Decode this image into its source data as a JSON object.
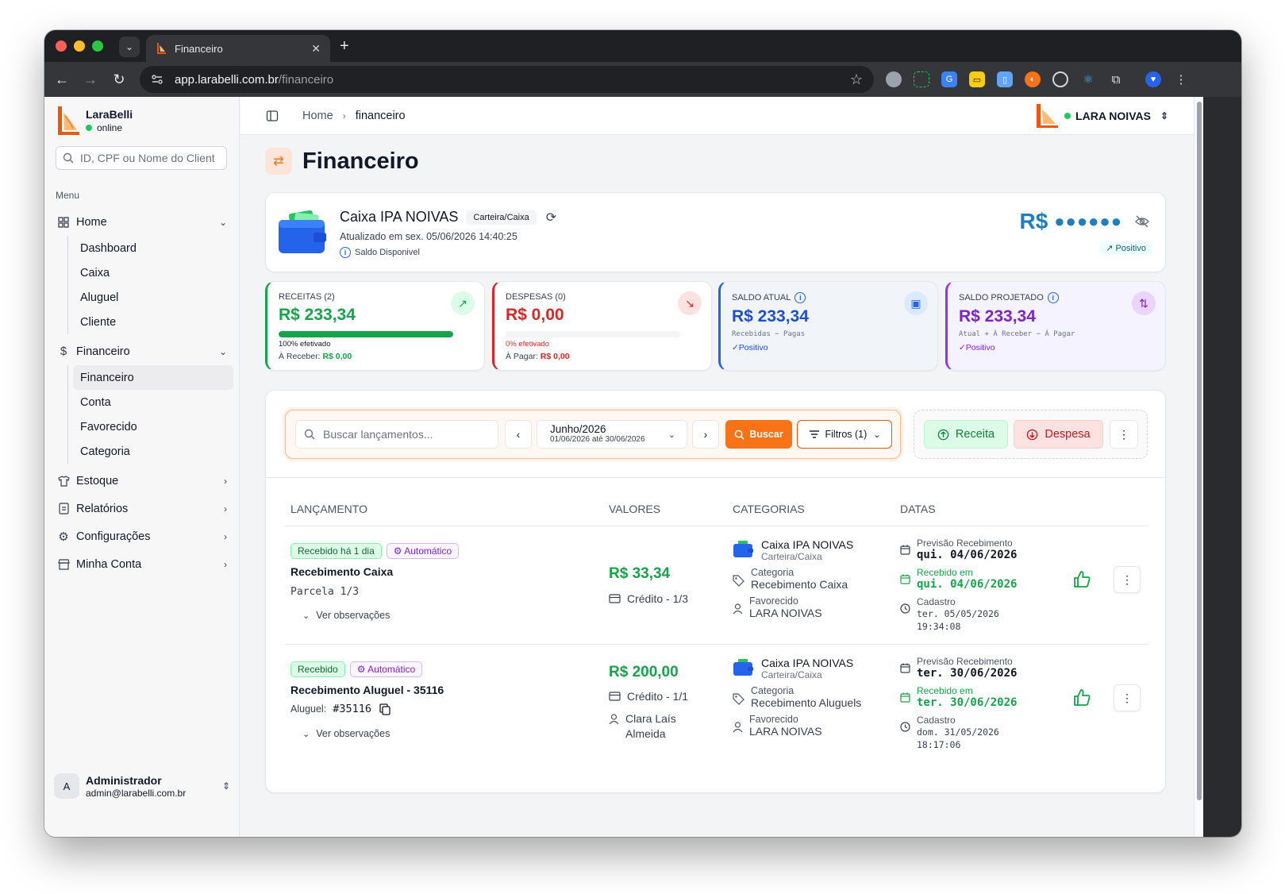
{
  "browser": {
    "tab_title": "Financeiro",
    "url_host": "app.larabelli.com.br",
    "url_path": "/financeiro"
  },
  "sidebar": {
    "brand_name": "LaraBelli",
    "brand_status": "online",
    "search_placeholder": "ID, CPF ou Nome do Cliente",
    "menu_label": "Menu",
    "groups": [
      {
        "label": "Home",
        "items": [
          "Dashboard",
          "Caixa",
          "Aluguel",
          "Cliente"
        ]
      },
      {
        "label": "Financeiro",
        "items": [
          "Financeiro",
          "Conta",
          "Favorecido",
          "Categoria"
        ]
      },
      {
        "label": "Estoque"
      },
      {
        "label": "Relatórios"
      },
      {
        "label": "Configurações"
      },
      {
        "label": "Minha Conta"
      }
    ],
    "user": {
      "initial": "A",
      "name": "Administrador",
      "email": "admin@larabelli.com.br"
    }
  },
  "topbar": {
    "breadcrumb": [
      "Home",
      "financeiro"
    ],
    "tenant": "LARA NOIVAS"
  },
  "page": {
    "title": "Financeiro"
  },
  "caixa": {
    "name": "Caixa IPA NOIVAS",
    "type": "Carteira/Caixa",
    "updated": "Atualizado em sex. 05/06/2026 14:40:25",
    "saldo_label": "Saldo Disponivel",
    "currency": "R$",
    "masked": "●●●●●●",
    "status": "Positivo"
  },
  "kpis": {
    "receitas": {
      "label": "RECEITAS (2)",
      "value": "R$ 233,34",
      "progress": 100,
      "progress_text": "100% efetivado",
      "sub_label": "À Receber:",
      "sub_value": "R$ 0,00"
    },
    "despesas": {
      "label": "DESPESAS (0)",
      "value": "R$ 0,00",
      "progress": 0,
      "progress_text": "0% efetivado",
      "sub_label": "À Pagar:",
      "sub_value": "R$ 0,00"
    },
    "saldo_atual": {
      "label": "SALDO ATUAL",
      "value": "R$ 233,34",
      "formula": "Recebidas − Pagas",
      "status": "✓Positivo"
    },
    "saldo_projetado": {
      "label": "SALDO PROJETADO",
      "value": "R$ 233,34",
      "formula": "Atual + À Receber − À Pagar",
      "status": "✓Positivo"
    }
  },
  "filters": {
    "search_placeholder": "Buscar lançamentos...",
    "month": "Junho/2026",
    "range": "01/06/2026 até 30/06/2026",
    "buscar": "Buscar",
    "filtros": "Filtros (1)",
    "receita": "Receita",
    "despesa": "Despesa"
  },
  "table": {
    "headers": [
      "LANÇAMENTO",
      "VALORES",
      "CATEGORIAS",
      "DATAS"
    ],
    "rows": [
      {
        "status_badge": "Recebido há 1 dia",
        "auto_badge": "Automático",
        "title": "Recebimento Caixa",
        "detail": "Parcela 1/3",
        "obs": "Ver observações",
        "value": "R$ 33,34",
        "payment": "Crédito - 1/3",
        "account": "Caixa IPA NOIVAS",
        "account_type": "Carteira/Caixa",
        "category_label": "Categoria",
        "category": "Recebimento Caixa",
        "favorecido_label": "Favorecido",
        "favorecido": "LARA NOIVAS",
        "prev_label": "Previsão Recebimento",
        "prev_date": "qui. 04/06/2026",
        "rec_label": "Recebido em",
        "rec_date": "qui. 04/06/2026",
        "cad_label": "Cadastro",
        "cad_date": "ter. 05/05/2026",
        "cad_time": "19:34:08"
      },
      {
        "status_badge": "Recebido",
        "auto_badge": "Automático",
        "title": "Recebimento Aluguel - 35116",
        "aluguel_label": "Aluguel:",
        "aluguel_num": "#35116",
        "obs": "Ver observações",
        "value": "R$ 200,00",
        "payment": "Crédito - 1/1",
        "client": "Clara Laís Almeida",
        "account": "Caixa IPA NOIVAS",
        "account_type": "Carteira/Caixa",
        "category_label": "Categoria",
        "category": "Recebimento Aluguels",
        "favorecido_label": "Favorecido",
        "favorecido": "LARA NOIVAS",
        "prev_label": "Previsão Recebimento",
        "prev_date": "ter. 30/06/2026",
        "rec_label": "Recebido em",
        "rec_date": "ter. 30/06/2026",
        "cad_label": "Cadastro",
        "cad_date": "dom. 31/05/2026",
        "cad_time": "18:17:06"
      }
    ]
  },
  "colors": {
    "accent": "#f97316",
    "income": "#16a34a",
    "expense": "#dc2626",
    "balance": "#1e7fbf"
  }
}
